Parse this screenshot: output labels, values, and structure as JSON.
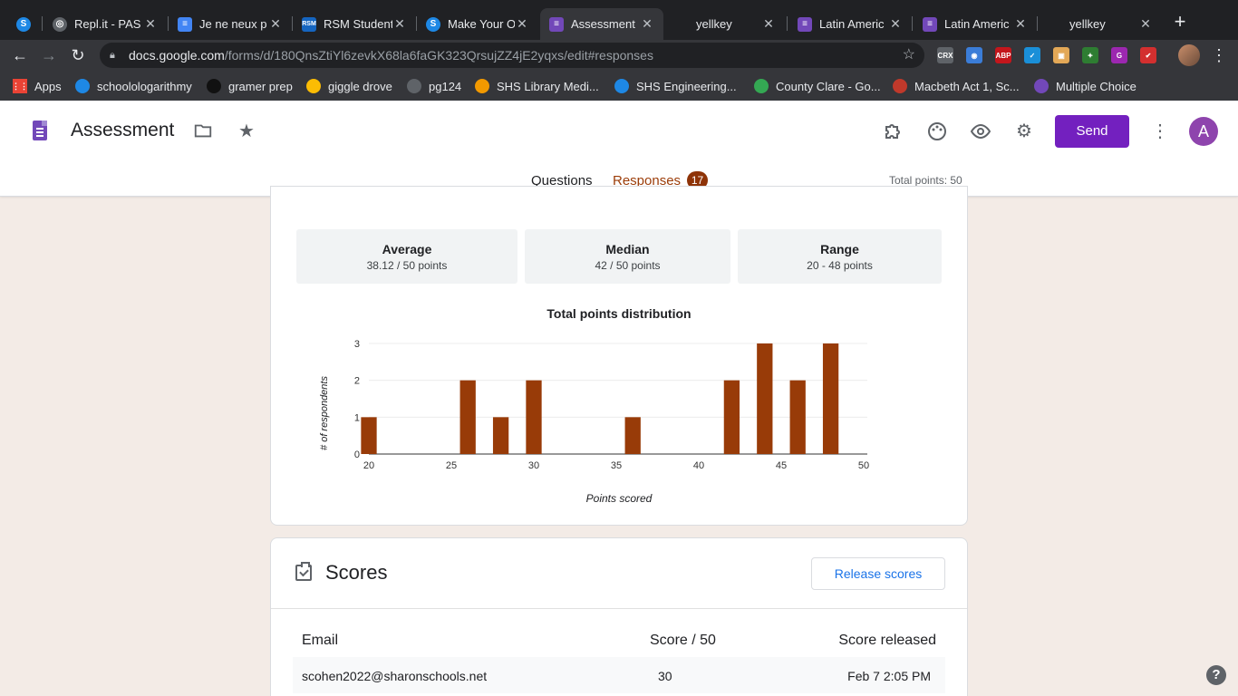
{
  "browser": {
    "tabs": [
      {
        "title": "",
        "icon": "s-icon",
        "color": "#1e88e5"
      },
      {
        "title": "Repl.it - PAS",
        "icon": "replit-icon",
        "color": "#5f6368"
      },
      {
        "title": "Je ne neux p",
        "icon": "docs-icon",
        "color": "#4285f4"
      },
      {
        "title": "RSM Student",
        "icon": "rsm-icon",
        "color": "#1565c0"
      },
      {
        "title": "Make Your O",
        "icon": "s-icon",
        "color": "#1e88e5"
      },
      {
        "title": "Assessment",
        "icon": "forms-icon",
        "color": "#7248b9",
        "active": true
      },
      {
        "title": "yellkey",
        "icon": "blank-icon",
        "color": "#35363a"
      },
      {
        "title": "Latin Americ",
        "icon": "forms-icon",
        "color": "#7248b9"
      },
      {
        "title": "Latin Americ",
        "icon": "forms-icon",
        "color": "#7248b9"
      },
      {
        "title": "yellkey",
        "icon": "blank-icon",
        "color": "#35363a"
      }
    ],
    "url_host": "docs.google.com",
    "url_path": "/forms/d/180QnsZtiYl6zevkX68la6faGK323QrsujZZ4jE2yqxs/edit#responses",
    "bookmarks": [
      {
        "label": "Apps",
        "icon": "apps-grid-icon",
        "color": "#ea4335"
      },
      {
        "label": "schoolologarithmy",
        "icon": "s-icon",
        "color": "#1e88e5"
      },
      {
        "label": "gramer prep",
        "icon": "gb-icon",
        "color": "#111111"
      },
      {
        "label": "giggle drove",
        "icon": "drive-icon",
        "color": "#fbbc04"
      },
      {
        "label": "pg124",
        "icon": "globe-icon",
        "color": "#5f6368"
      },
      {
        "label": "SHS Library Medi...",
        "icon": "library-icon",
        "color": "#f29900"
      },
      {
        "label": "SHS Engineering...",
        "icon": "s-icon",
        "color": "#1e88e5"
      },
      {
        "label": "County Clare - Go...",
        "icon": "maps-icon",
        "color": "#34a853"
      },
      {
        "label": "Macbeth Act 1, Sc...",
        "icon": "macbeth-icon",
        "color": "#c0392b"
      },
      {
        "label": "Multiple Choice",
        "icon": "forms-icon",
        "color": "#7248b9"
      }
    ],
    "extensions": [
      {
        "name": "crx-icon",
        "label": "CRX",
        "color": "#5f6368"
      },
      {
        "name": "owl-icon",
        "label": "◉",
        "color": "#3b7dd8"
      },
      {
        "name": "adblock-icon",
        "label": "ABP",
        "color": "#c4161c"
      },
      {
        "name": "check-icon",
        "label": "✓",
        "color": "#1a8fd8"
      },
      {
        "name": "box-icon",
        "label": "▣",
        "color": "#e3a857"
      },
      {
        "name": "leaf-icon",
        "label": "✦",
        "color": "#2e7d32"
      },
      {
        "name": "color-icon",
        "label": "G",
        "color": "#9c27b0"
      },
      {
        "name": "checkmark-red-icon",
        "label": "✔",
        "color": "#d32f2f"
      }
    ]
  },
  "forms": {
    "title": "Assessment",
    "send_label": "Send",
    "avatar_letter": "A",
    "tabs": {
      "questions": "Questions",
      "responses": "Responses"
    },
    "response_count": "17",
    "total_points": "Total points: 50"
  },
  "summary": {
    "stats": [
      {
        "label": "Average",
        "value": "38.12 / 50 points"
      },
      {
        "label": "Median",
        "value": "42 / 50 points"
      },
      {
        "label": "Range",
        "value": "20 - 48 points"
      }
    ]
  },
  "chart_data": {
    "type": "bar",
    "title": "Total points distribution",
    "xlabel": "Points scored",
    "ylabel": "# of respondents",
    "xlim": [
      20,
      50
    ],
    "ylim": [
      0,
      3
    ],
    "xticks": [
      20,
      25,
      30,
      35,
      40,
      45,
      50
    ],
    "yticks": [
      0,
      1,
      2,
      3
    ],
    "x": [
      20,
      26,
      28,
      30,
      36,
      42,
      44,
      46,
      48
    ],
    "values": [
      1,
      2,
      1,
      2,
      1,
      2,
      3,
      2,
      3
    ],
    "color": "#983b08",
    "grid": true
  },
  "scores": {
    "title": "Scores",
    "release_label": "Release scores",
    "columns": [
      "Email",
      "Score / 50",
      "Score released"
    ],
    "rows": [
      {
        "email": "scohen2022@sharonschools.net",
        "score": "30",
        "released": "Feb 7 2:05 PM"
      }
    ]
  },
  "help_label": "?"
}
